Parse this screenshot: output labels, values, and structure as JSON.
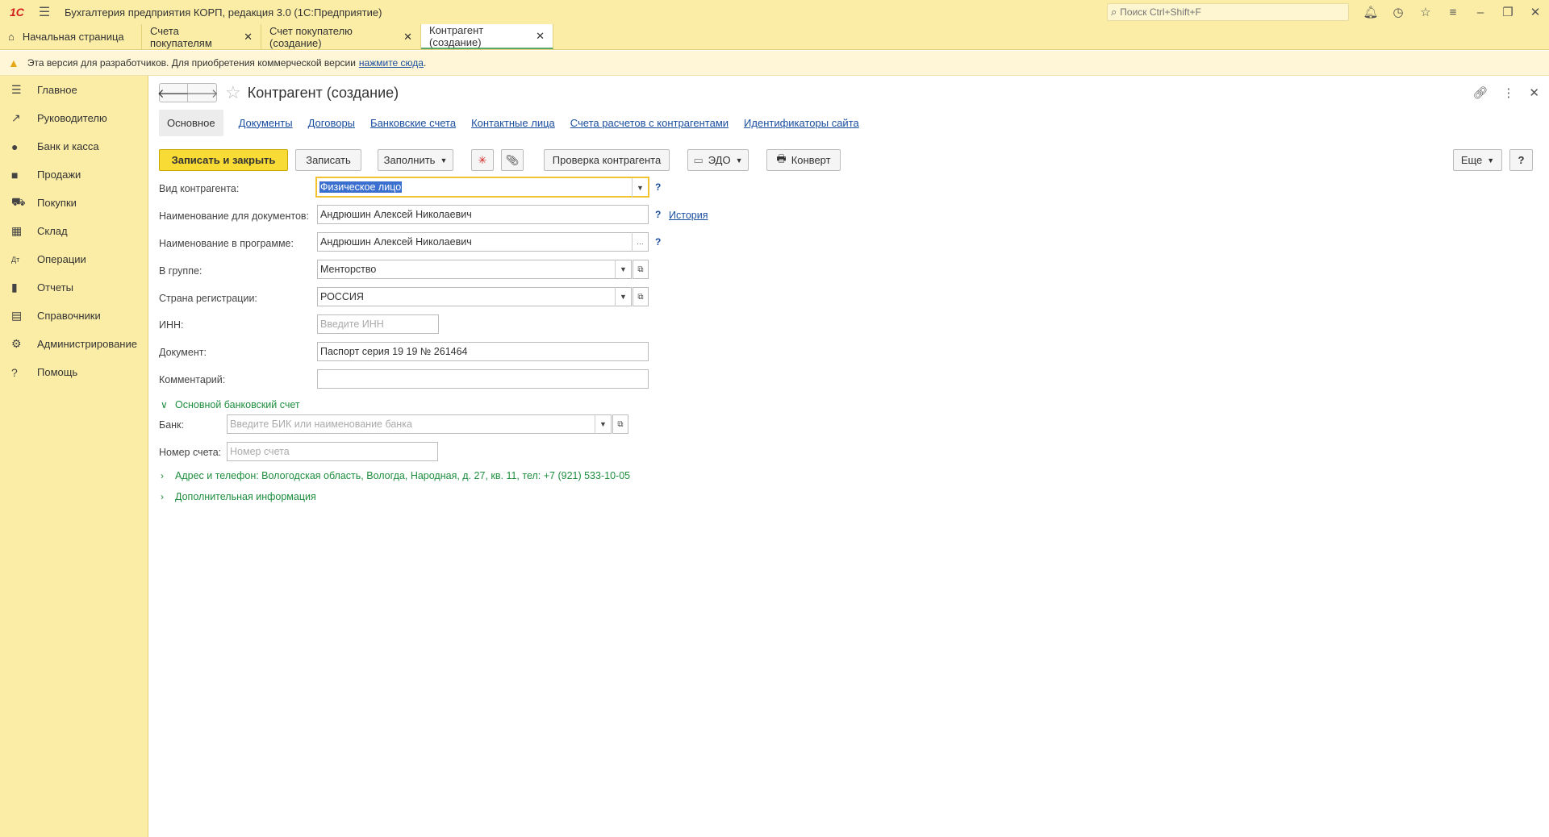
{
  "titlebar": {
    "logo": "1С",
    "app_title": "Бухгалтерия предприятия КОРП, редакция 3.0  (1С:Предприятие)",
    "search_placeholder": "Поиск Ctrl+Shift+F"
  },
  "tabs": [
    {
      "label": "Начальная страница"
    },
    {
      "label": "Счета покупателям"
    },
    {
      "label": "Счет покупателю (создание)"
    },
    {
      "label": "Контрагент (создание)"
    }
  ],
  "notice": {
    "text": "Эта версия для разработчиков. Для приобретения коммерческой версии",
    "link": "нажмите сюда",
    "tail": "."
  },
  "sidebar": {
    "items": [
      {
        "label": "Главное",
        "icon": "menu-icon"
      },
      {
        "label": "Руководителю",
        "icon": "trend-icon"
      },
      {
        "label": "Банк и касса",
        "icon": "coin-icon"
      },
      {
        "label": "Продажи",
        "icon": "bag-icon"
      },
      {
        "label": "Покупки",
        "icon": "cart-icon"
      },
      {
        "label": "Склад",
        "icon": "grid-icon"
      },
      {
        "label": "Операции",
        "icon": "dt-kt-icon"
      },
      {
        "label": "Отчеты",
        "icon": "bar-chart-icon"
      },
      {
        "label": "Справочники",
        "icon": "books-icon"
      },
      {
        "label": "Администрирование",
        "icon": "gear-icon"
      },
      {
        "label": "Помощь",
        "icon": "help-icon"
      }
    ]
  },
  "form": {
    "title": "Контрагент (создание)",
    "subtabs": [
      {
        "label": "Основное"
      },
      {
        "label": "Документы"
      },
      {
        "label": "Договоры"
      },
      {
        "label": "Банковские счета"
      },
      {
        "label": "Контактные лица"
      },
      {
        "label": "Счета расчетов с контрагентами"
      },
      {
        "label": "Идентификаторы сайта"
      }
    ],
    "toolbar": {
      "save_close": "Записать и закрыть",
      "save": "Записать",
      "fill": "Заполнить",
      "check": "Проверка контрагента",
      "edo": "ЭДО",
      "envelope": "Конверт",
      "more": "Еще",
      "help": "?"
    },
    "fields": {
      "kind_label": "Вид контрагента:",
      "kind_value": "Физическое лицо",
      "docname_label": "Наименование для документов:",
      "docname_value": "Андрюшин Алексей Николаевич",
      "history_link": "История",
      "progname_label": "Наименование в программе:",
      "progname_value": "Андрюшин Алексей Николаевич",
      "group_label": "В группе:",
      "group_value": "Менторство",
      "country_label": "Страна регистрации:",
      "country_value": "РОССИЯ",
      "inn_label": "ИНН:",
      "inn_placeholder": "Введите ИНН",
      "doc_label": "Документ:",
      "doc_value": "Паспорт серия 19 19 № 261464",
      "comment_label": "Комментарий:",
      "comment_value": ""
    },
    "bank_group": {
      "title": "Основной банковский счет",
      "bank_label": "Банк:",
      "bank_placeholder": "Введите БИК или наименование банка",
      "account_label": "Номер счета:",
      "account_placeholder": "Номер счета"
    },
    "address_group": "Адрес и телефон: Вологодская область, Вологда, Народная, д. 27, кв. 11, тел: +7 (921) 533-10-05",
    "extra_group": "Дополнительная информация"
  }
}
